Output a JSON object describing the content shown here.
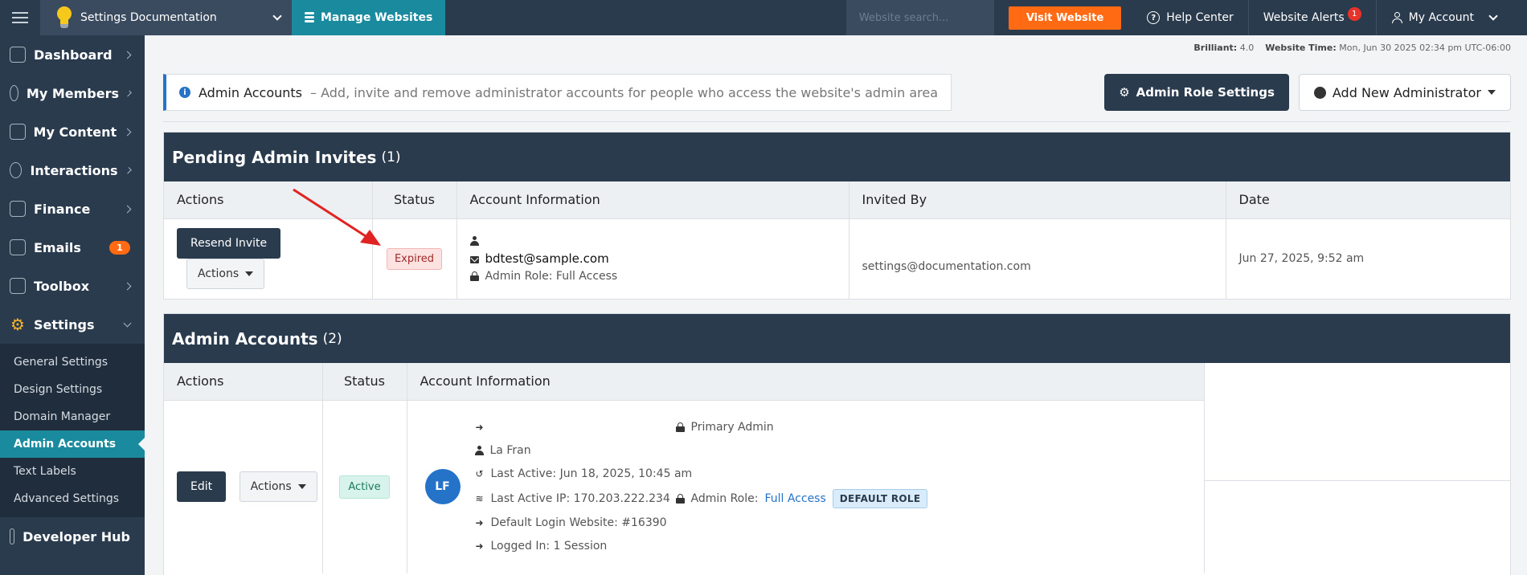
{
  "topbar": {
    "site_name": "Settings Documentation",
    "manage_label": "Manage Websites",
    "search_placeholder": "Website search...",
    "visit_label": "Visit Website",
    "help_label": "Help Center",
    "alerts_label": "Website Alerts",
    "alerts_count": "1",
    "account_label": "My Account"
  },
  "sidebar": {
    "items": [
      {
        "label": "Dashboard"
      },
      {
        "label": "My Members"
      },
      {
        "label": "My Content"
      },
      {
        "label": "Interactions"
      },
      {
        "label": "Finance"
      },
      {
        "label": "Emails",
        "badge": "1"
      },
      {
        "label": "Toolbox"
      },
      {
        "label": "Settings"
      }
    ],
    "settings_sub": [
      {
        "label": "General Settings"
      },
      {
        "label": "Design Settings"
      },
      {
        "label": "Domain Manager"
      },
      {
        "label": "Admin Accounts"
      },
      {
        "label": "Text Labels"
      },
      {
        "label": "Advanced Settings"
      }
    ],
    "developer_hub": "Developer Hub"
  },
  "meta": {
    "version_label": "Brilliant:",
    "version_value": "4.0",
    "time_label": "Website Time:",
    "time_value": "Mon, Jun 30 2025 02:34 pm UTC-06:00"
  },
  "header": {
    "title": "Admin Accounts",
    "description": "– Add, invite and remove administrator accounts for people who access the website's admin area",
    "role_settings_label": "Admin Role Settings",
    "add_admin_label": "Add New Administrator"
  },
  "pending": {
    "title": "Pending Admin Invites",
    "count": "(1)",
    "columns": [
      "Actions",
      "Status",
      "Account Information",
      "Invited By",
      "Date"
    ],
    "row": {
      "resend_label": "Resend Invite",
      "actions_label": "Actions",
      "status": "Expired",
      "email": "bdtest@sample.com",
      "role": "Admin Role: Full Access",
      "invited_by": "settings@documentation.com",
      "date": "Jun 27, 2025, 9:52 am"
    }
  },
  "admins": {
    "title": "Admin Accounts",
    "count": "(2)",
    "columns": [
      "Actions",
      "Status",
      "Account Information"
    ],
    "row": {
      "edit_label": "Edit",
      "actions_label": "Actions",
      "status": "Active",
      "avatar_initials": "LF",
      "primary_admin": "Primary Admin",
      "name": "La Fran",
      "last_active": "Last Active: Jun 18, 2025, 10:45 am",
      "last_ip": "Last Active IP: 170.203.222.234",
      "role_label": "Admin Role:",
      "role_value": "Full Access",
      "default_role": "DEFAULT ROLE",
      "default_login": "Default Login Website: #16390",
      "logged_in": "Logged In: 1 Session"
    }
  },
  "colors": {
    "navy": "#2b3b4e",
    "teal": "#1a8a9e",
    "orange": "#ff6a13",
    "blue": "#2573c9",
    "arrow_red": "#e02424"
  }
}
